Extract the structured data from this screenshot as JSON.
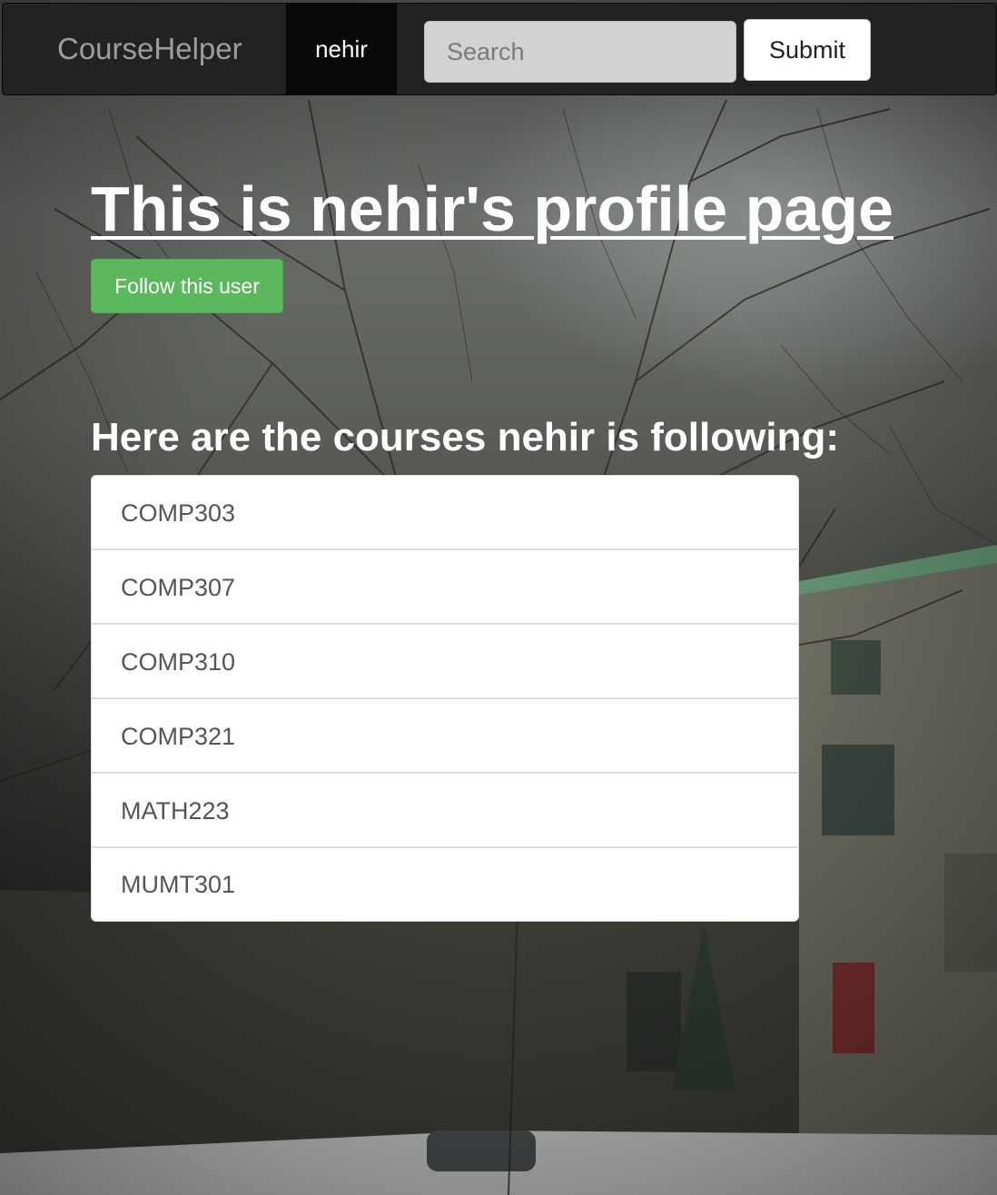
{
  "navbar": {
    "brand": "CourseHelper",
    "active_user": "nehir",
    "search": {
      "placeholder": "Search",
      "value": ""
    },
    "submit_label": "Submit"
  },
  "profile": {
    "title": "This is nehir's profile page",
    "follow_label": "Follow this user",
    "follow_color": "#5cb85c"
  },
  "courses": {
    "heading": "Here are the courses nehir is following:",
    "items": [
      "COMP303",
      "COMP307",
      "COMP310",
      "COMP321",
      "MATH223",
      "MUMT301"
    ]
  }
}
